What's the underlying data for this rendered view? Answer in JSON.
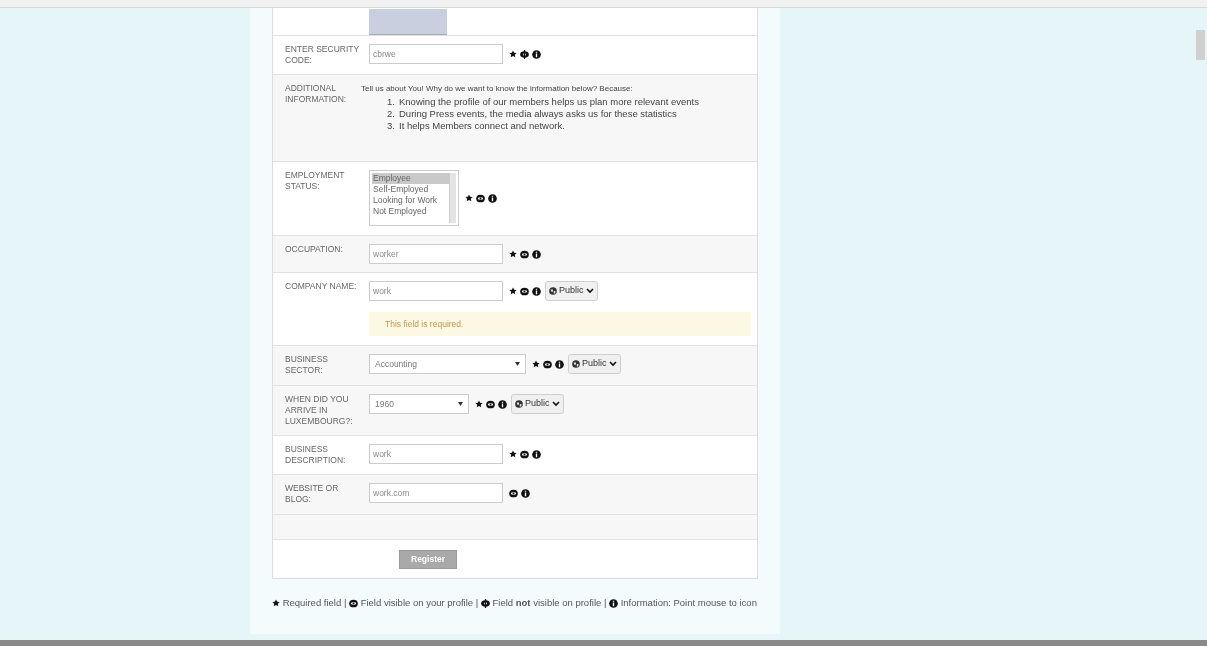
{
  "rows": [
    {
      "kind": "captcha",
      "label": ""
    },
    {
      "kind": "input",
      "label": "ENTER SECURITY CODE:",
      "value": "cbrwe",
      "icons": [
        {
          "kind": "required"
        },
        {
          "kind": "hidden"
        },
        {
          "kind": "info"
        }
      ]
    },
    {
      "kind": "info",
      "label": "ADDITIONAL INFORMATION:",
      "intro": "Tell us about You!  Why do we want to know the information below?  Because:",
      "points": [
        {
          "number": "1.",
          "text": "Knowing the profile of our members helps us plan more relevant events"
        },
        {
          "number": "2.",
          "text": "During Press events, the media always asks us for these statistics"
        },
        {
          "number": "3.",
          "text": "It helps Members connect and network."
        }
      ]
    },
    {
      "kind": "listbox",
      "label": "EMPLOYMENT STATUS:",
      "options": [
        {
          "label": "Employee",
          "selected": true
        },
        {
          "label": "Self-Employed",
          "selected": false
        },
        {
          "label": "Looking for Work",
          "selected": false
        },
        {
          "label": "Not Employed",
          "selected": false
        }
      ],
      "icons": [
        {
          "kind": "required"
        },
        {
          "kind": "visible"
        },
        {
          "kind": "info"
        }
      ]
    },
    {
      "kind": "input",
      "label": "OCCUPATION:",
      "value": "worker",
      "icons": [
        {
          "kind": "required"
        },
        {
          "kind": "visible"
        },
        {
          "kind": "info"
        }
      ]
    },
    {
      "kind": "input",
      "label": "COMPANY NAME:",
      "value": "work",
      "icons": [
        {
          "kind": "required"
        },
        {
          "kind": "visible"
        },
        {
          "kind": "info"
        }
      ],
      "privacy": "Public",
      "error": "This field is required."
    },
    {
      "kind": "select",
      "label": "BUSINESS SECTOR:",
      "value": "Accounting",
      "icons": [
        {
          "kind": "required"
        },
        {
          "kind": "visible"
        },
        {
          "kind": "info"
        }
      ],
      "privacy": "Public"
    },
    {
      "kind": "select",
      "label": "WHEN DID YOU ARRIVE IN LUXEMBOURG?:",
      "value": "1960",
      "icons": [
        {
          "kind": "required"
        },
        {
          "kind": "visible"
        },
        {
          "kind": "info"
        }
      ],
      "privacy": "Public"
    },
    {
      "kind": "input",
      "label": "BUSINESS DESCRIPTION:",
      "value": "work",
      "icons": [
        {
          "kind": "required"
        },
        {
          "kind": "visible"
        },
        {
          "kind": "info"
        }
      ]
    },
    {
      "kind": "input",
      "label": "WEBSITE OR BLOG:",
      "value": "work.com",
      "icons": [
        {
          "kind": "visible"
        },
        {
          "kind": "info"
        }
      ]
    },
    {
      "kind": "empty",
      "label": ""
    }
  ],
  "register_button": "Register",
  "legend": [
    {
      "kind": "required",
      "text": "Required field |"
    },
    {
      "kind": "visible",
      "text": "Field visible on your profile |"
    },
    {
      "kind": "hidden",
      "text": "Field **not** visible on profile |"
    },
    {
      "kind": "info",
      "text": "Information: Point mouse to icon"
    }
  ]
}
